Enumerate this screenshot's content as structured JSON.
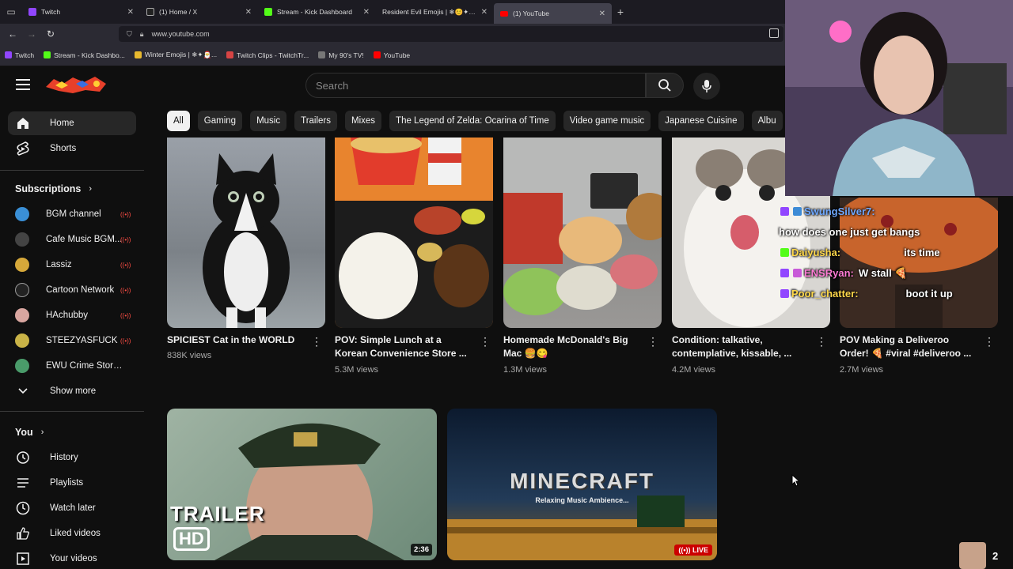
{
  "browser": {
    "tabs": [
      {
        "label": "Twitch",
        "color": "#9146ff"
      },
      {
        "label": "(1) Home / X",
        "color": "#222222"
      },
      {
        "label": "Stream - Kick Dashboard",
        "color": "#53fc18"
      },
      {
        "label": "Resident Evil Emojis | ❄😊✦🎅 | Co",
        "color": "#888888"
      },
      {
        "label": "(1) YouTube",
        "color": "#ff0000"
      }
    ],
    "url": "www.youtube.com",
    "bookmarks": [
      {
        "label": "Twitch",
        "color": "#9146ff"
      },
      {
        "label": "Stream - Kick Dashbo...",
        "color": "#53fc18"
      },
      {
        "label": "Winter Emojis | ❄✦🎅...",
        "color": "#e8b92e"
      },
      {
        "label": "Twitch Clips - TwitchTr...",
        "color": "#d64444"
      },
      {
        "label": "My 90's TV!",
        "color": "#777777"
      },
      {
        "label": "YouTube",
        "color": "#ff0000"
      }
    ]
  },
  "header": {
    "search_placeholder": "Search"
  },
  "chips": [
    "All",
    "Gaming",
    "Music",
    "Trailers",
    "Mixes",
    "The Legend of Zelda: Ocarina of Time",
    "Video game music",
    "Japanese Cuisine",
    "Albu"
  ],
  "sidebar": {
    "home": "Home",
    "shorts": "Shorts",
    "subscriptions_title": "Subscriptions",
    "subscriptions": [
      {
        "label": "BGM channel",
        "color": "#3a8fd6"
      },
      {
        "label": "Cafe Music BGM...",
        "color": "#444444"
      },
      {
        "label": "Lassiz",
        "color": "#d6a83a"
      },
      {
        "label": "Cartoon Network",
        "color": "#222222"
      },
      {
        "label": "HAchubby",
        "color": "#d9a6a0"
      },
      {
        "label": "STEEZYASFUCK",
        "color": "#c9b347"
      },
      {
        "label": "EWU Crime Storyti...",
        "color": "#4a9b6a"
      }
    ],
    "show_more": "Show more",
    "you_title": "You",
    "you_items": [
      "History",
      "Playlists",
      "Watch later",
      "Liked videos",
      "Your videos"
    ]
  },
  "videos_row1": [
    {
      "title1": "SPICIEST Cat in the WORLD",
      "title2": "",
      "views": "838K views"
    },
    {
      "title1": "POV: Simple Lunch at a",
      "title2": "Korean Convenience Store ...",
      "views": "5.3M views"
    },
    {
      "title1": "Homemade McDonald's Big",
      "title2": "Mac 🍔😋",
      "views": "1.3M views"
    },
    {
      "title1": "Condition: talkative,",
      "title2": "contemplative, kissable, ...",
      "views": "4.2M views"
    },
    {
      "title1": "POV Making a Deliveroo",
      "title2": "Order! 🍕 #viral #deliveroo ...",
      "views": "2.7M views"
    }
  ],
  "videos_row2": [
    {
      "overlay1": "TRAILER",
      "overlay2": "HD",
      "duration": "2:36"
    },
    {
      "overlay1": "MINECRAFT",
      "overlay2": "Relaxing Music Ambience...",
      "badge": "LIVE"
    }
  ],
  "overlay": {
    "chat": [
      {
        "user": "SwungSilver7:",
        "msg": "how does one just get bangs",
        "color": "#6fa8ff"
      },
      {
        "user": "Daiyusha:",
        "msg": "its time",
        "color": "#ffd84a"
      },
      {
        "user": "ENSRyan:",
        "msg": "W stall 🍕",
        "color": "#ff7bd5"
      },
      {
        "user": "Poor_chatter:",
        "msg": "boot it up",
        "color": "#ffd84a"
      }
    ],
    "viewer_count": "2"
  }
}
